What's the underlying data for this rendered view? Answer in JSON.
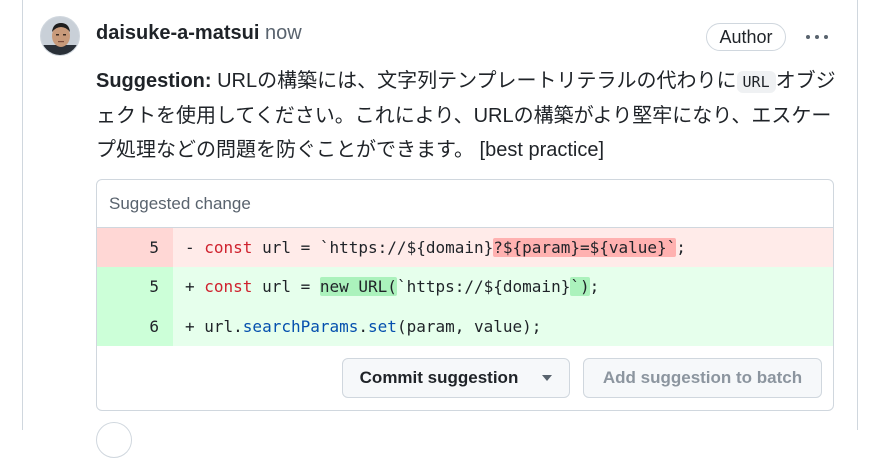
{
  "comment": {
    "username": "daisuke-a-matsui",
    "timestamp": "now",
    "badge": "Author",
    "more_icon": "kebab-horizontal-icon",
    "body": {
      "label": "Suggestion:",
      "text_before": " URLの構築には、文字列テンプレートリテラルの代わりに",
      "inline_code": "URL",
      "text_after": "オブジェクトを使用してください。これにより、URLの構築がより堅牢になり、エスケープ処理などの問題を防ぐことができます。 [best practice]"
    }
  },
  "suggestion": {
    "header": "Suggested change",
    "lines": [
      {
        "type": "deletion",
        "line_number": "5",
        "prefix": "- ",
        "kw": "const",
        "text_1": " url = `https://${domain}",
        "highlight": "?${param}=${value}`",
        "text_2": ";"
      },
      {
        "type": "addition",
        "line_number": "5",
        "prefix": "+ ",
        "kw": "const",
        "text_1": " url = ",
        "highlight_1": "new URL(",
        "text_2": "`https://${domain}",
        "highlight_2": "`)",
        "text_3": ";"
      },
      {
        "type": "addition",
        "line_number": "6",
        "prefix": "+ ",
        "text_1": "url.",
        "fn_1": "searchParams",
        "text_2": ".",
        "fn_2": "set",
        "text_3": "(param, value);"
      }
    ],
    "commit_button": "Commit suggestion",
    "batch_button": "Add suggestion to batch"
  },
  "colors": {
    "deletion_bg": "#ffebe9",
    "addition_bg": "#e6ffec",
    "keyword": "#cf222e",
    "function": "#0550ae"
  }
}
